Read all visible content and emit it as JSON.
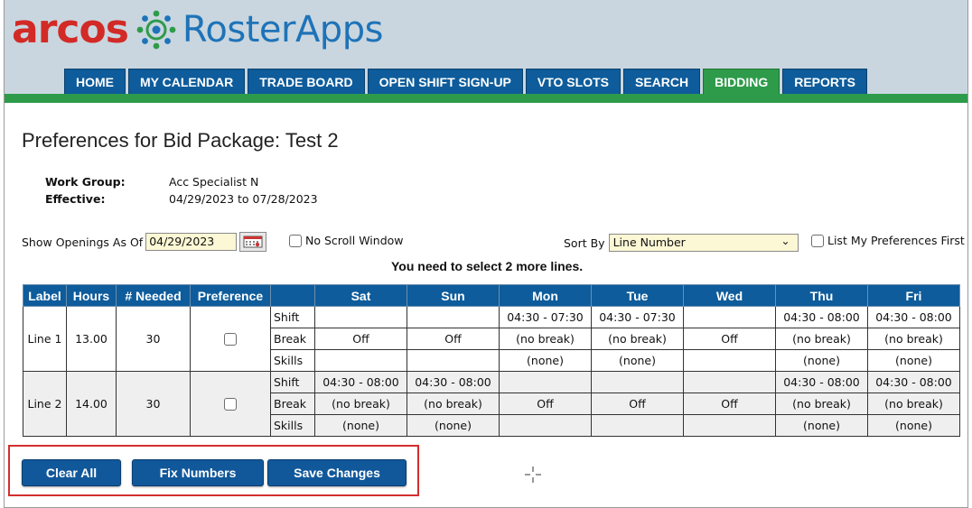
{
  "logo": {
    "brand": "arcos",
    "product": "RosterApps"
  },
  "nav": {
    "tabs": [
      {
        "label": "HOME",
        "active": false
      },
      {
        "label": "MY CALENDAR",
        "active": false
      },
      {
        "label": "TRADE BOARD",
        "active": false
      },
      {
        "label": "OPEN SHIFT SIGN-UP",
        "active": false
      },
      {
        "label": "VTO SLOTS",
        "active": false
      },
      {
        "label": "SEARCH",
        "active": false
      },
      {
        "label": "BIDDING",
        "active": true
      },
      {
        "label": "REPORTS",
        "active": false
      }
    ]
  },
  "page": {
    "title": "Preferences for Bid Package: Test 2",
    "work_group_label": "Work Group:",
    "work_group_value": "Acc Specialist N",
    "effective_label": "Effective:",
    "effective_value": "04/29/2023 to 07/28/2023"
  },
  "filters": {
    "show_openings_label": "Show Openings As Of",
    "show_openings_value": "04/29/2023",
    "no_scroll_label": "No Scroll Window",
    "sort_by_label": "Sort By",
    "sort_by_value": "Line Number",
    "list_prefs_first_label": "List My Preferences First"
  },
  "notice": "You need to select 2 more lines.",
  "table": {
    "headers": [
      "Label",
      "Hours",
      "# Needed",
      "Preference",
      "",
      "Sat",
      "Sun",
      "Mon",
      "Tue",
      "Wed",
      "Thu",
      "Fri"
    ],
    "lines": [
      {
        "label": "Line 1",
        "hours": "13.00",
        "needed": "30",
        "rows": [
          {
            "type": "Shift",
            "days": [
              "",
              "",
              "04:30 - 07:30",
              "04:30 - 07:30",
              "",
              "04:30 - 08:00",
              "04:30 - 08:00"
            ]
          },
          {
            "type": "Break",
            "days": [
              "Off",
              "Off",
              "(no break)",
              "(no break)",
              "Off",
              "(no break)",
              "(no break)"
            ]
          },
          {
            "type": "Skills",
            "days": [
              "",
              "",
              "(none)",
              "(none)",
              "",
              "(none)",
              "(none)"
            ]
          }
        ]
      },
      {
        "label": "Line 2",
        "hours": "14.00",
        "needed": "30",
        "rows": [
          {
            "type": "Shift",
            "days": [
              "04:30 - 08:00",
              "04:30 - 08:00",
              "",
              "",
              "",
              "04:30 - 08:00",
              "04:30 - 08:00"
            ]
          },
          {
            "type": "Break",
            "days": [
              "(no break)",
              "(no break)",
              "Off",
              "Off",
              "Off",
              "(no break)",
              "(no break)"
            ]
          },
          {
            "type": "Skills",
            "days": [
              "(none)",
              "(none)",
              "",
              "",
              "",
              "(none)",
              "(none)"
            ]
          }
        ]
      }
    ]
  },
  "buttons": {
    "clear_all": "Clear All",
    "fix_numbers": "Fix Numbers",
    "save_changes": "Save Changes"
  },
  "colors": {
    "nav_blue": "#0e5c9b",
    "active_green": "#2e9b4a",
    "brand_red": "#d22a26",
    "brand_blue": "#1e73b8",
    "highlight_red": "#d32f2f"
  }
}
